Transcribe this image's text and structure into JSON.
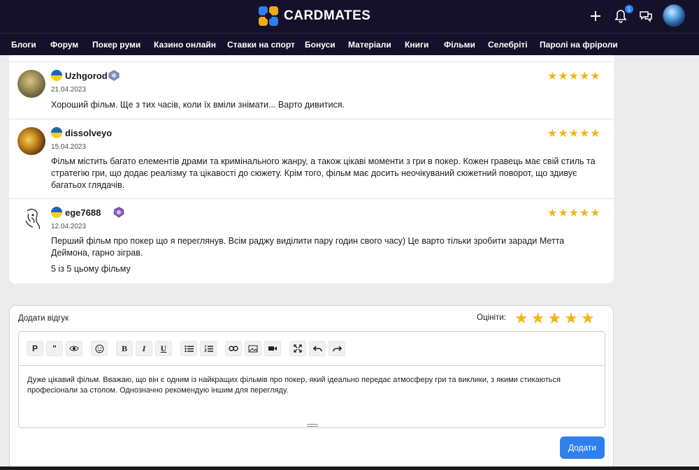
{
  "header": {
    "logo_text": "CARDMATES",
    "notification_count": "1",
    "icons": [
      "plus-icon",
      "bell-icon",
      "chat-icon",
      "user-avatar"
    ]
  },
  "nav": {
    "items": [
      "Блоги",
      "Форум",
      "Покер руми",
      "Казино онлайн",
      "Ставки на спорт",
      "Бонуси",
      "Матеріали",
      "Книги",
      "Фільми",
      "Селебріті",
      "Паролі на фріроли"
    ]
  },
  "reviews": [
    {
      "username": "Uzhgorod",
      "date": "21.04.2023",
      "text": "Хороший фільм. Ще з тих часів, коли їх вміли знімати... Варто дивитися.",
      "rating": 5
    },
    {
      "username": "dissolveyo",
      "date": "15.04.2023",
      "text": "Фільм містить багато елементів драми та кримінального жанру, а також цікаві моменти з гри в покер. Кожен гравець має свій стиль та стратегію гри, що додає реалізму та цікавості до сюжету. Крім того, фільм має досить неочікуваний сюжетний поворот, що здивує багатьох глядачів.",
      "rating": 5
    },
    {
      "username": "ege7688",
      "date": "12.04.2023",
      "text": "Перший фільм про покер що я переглянув. Всім раджу виділити пару годин свого часу) Це варто тільки зробити заради Метта Деймона, гарно зіграв.",
      "extra": "5 із 5 цьому фільму",
      "rating": 5
    }
  ],
  "add_review": {
    "title": "Додати відгук",
    "rate_label": "Оцініти:",
    "toolbar": [
      "P",
      "\"",
      "eye-icon",
      "smile-icon",
      "B",
      "I",
      "U",
      "bullet-list-icon",
      "numbered-list-icon",
      "link-icon",
      "image-icon",
      "video-icon",
      "fullscreen-icon",
      "undo-icon",
      "redo-icon"
    ],
    "text": "Дуже цікавий фільм. Вважаю, що він є одним із найкращих фільмів про покер, який ідеально передає атмосферу гри та виклики, з якими стикаються професіонали за столом. Однозначно рекомендую іншим для перегляду.",
    "submit_label": "Додати"
  },
  "colors": {
    "header_bg": "#16112a",
    "accent": "#2f80ed",
    "star": "#f2b418"
  }
}
